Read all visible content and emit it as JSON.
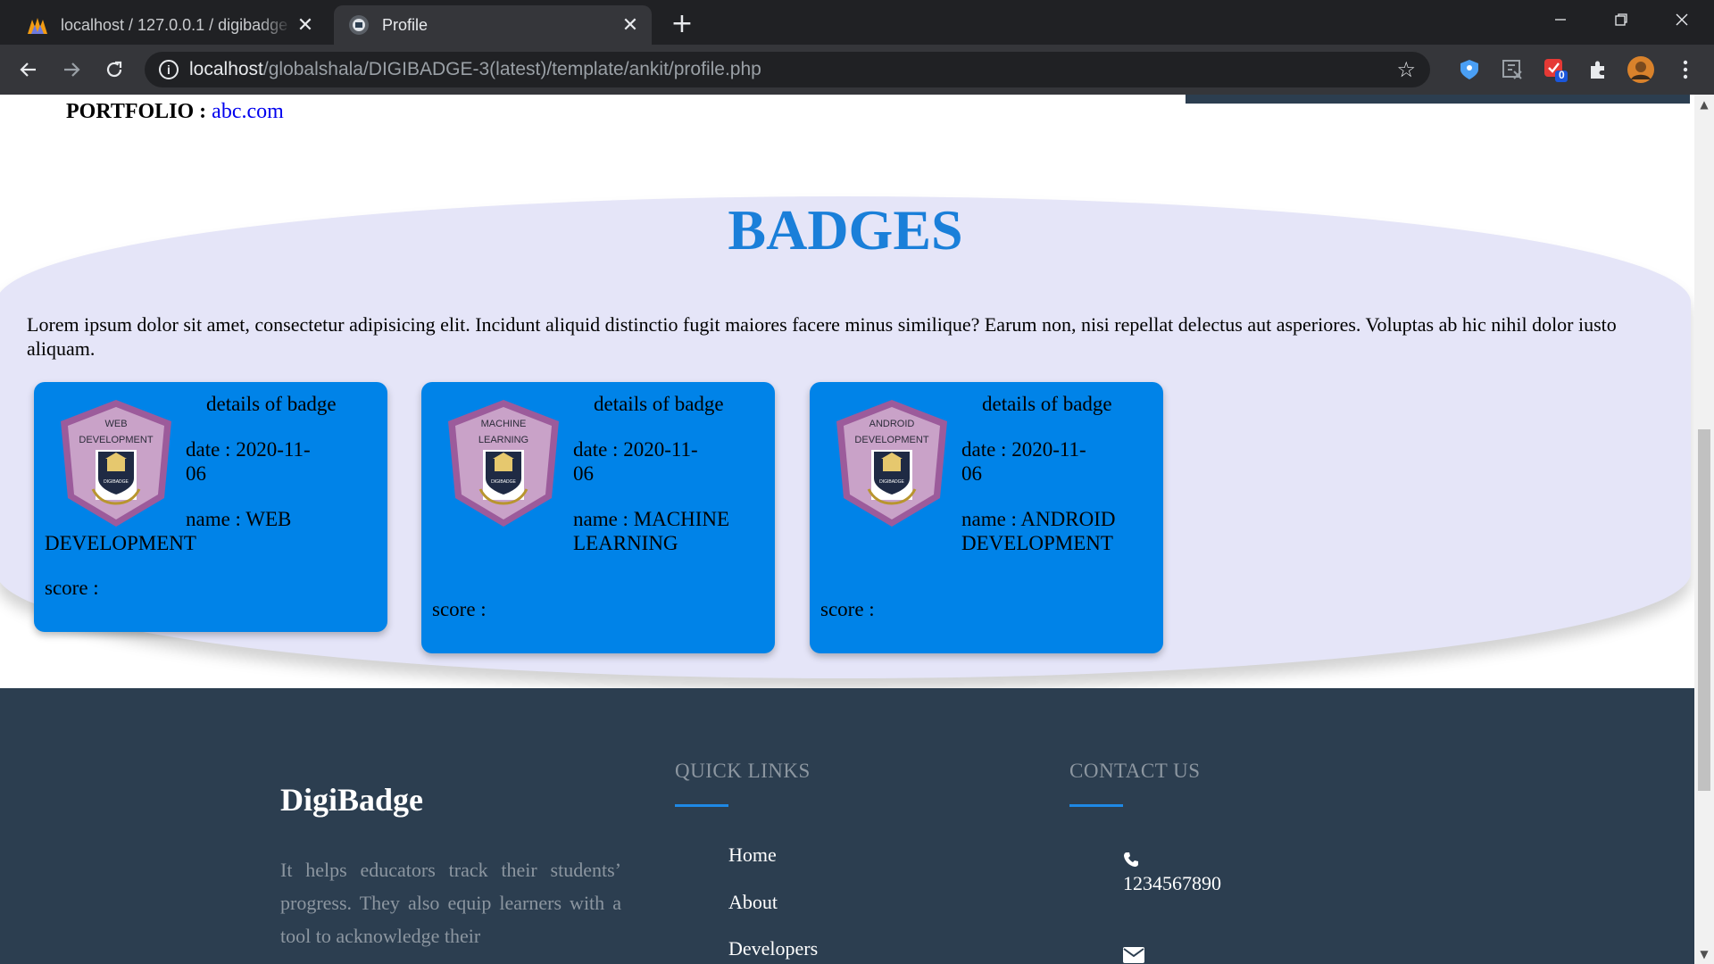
{
  "browser": {
    "tabs": [
      {
        "title": "localhost / 127.0.0.1 / digibadge",
        "active": false
      },
      {
        "title": "Profile",
        "active": true
      }
    ],
    "url_host": "localhost",
    "url_path": "/globalshala/DIGIBADGE-3(latest)/template/ankit/profile.php",
    "extension_badge": "0"
  },
  "profile": {
    "portfolio_label": "PORTFOLIO :",
    "portfolio_link": "abc.com"
  },
  "badges": {
    "title": "BADGES",
    "description": "Lorem ipsum dolor sit amet, consectetur adipisicing elit. Incidunt aliquid distinctio fugit maiores facere minus similique? Earum non, nisi repellat delectus aut asperiores. Voluptas ab hic nihil dolor iusto aliquam.",
    "cards": [
      {
        "heading": "details of badge",
        "emblem_line1": "WEB",
        "emblem_line2": "DEVELOPMENT",
        "date": "date : 2020-11-06",
        "name": "name : WEB DEVELOPMENT",
        "score": "score :"
      },
      {
        "heading": "details of badge",
        "emblem_line1": "MACHINE",
        "emblem_line2": "LEARNING",
        "date": "date : 2020-11-06",
        "name": "name : MACHINE LEARNING",
        "score": "score :"
      },
      {
        "heading": "details of badge",
        "emblem_line1": "ANDROID",
        "emblem_line2": "DEVELOPMENT",
        "date": "date : 2020-11-06",
        "name": "name : ANDROID DEVELOPMENT",
        "score": "score :"
      }
    ],
    "emblem_text": "DIGIBADGE"
  },
  "footer": {
    "brand": "DigiBadge",
    "about": "It helps educators track their students’ progress. They also equip learners with a tool to acknowledge their",
    "quick_links_heading": "QUICK LINKS",
    "quick_links": [
      "Home",
      "About",
      "Developers"
    ],
    "contact_heading": "CONTACT US",
    "phone": "1234567890"
  },
  "colors": {
    "accent": "#1a7fd9",
    "card": "#0083e8",
    "section_bg": "#e5e5f8",
    "footer_bg": "#2c3e50"
  }
}
